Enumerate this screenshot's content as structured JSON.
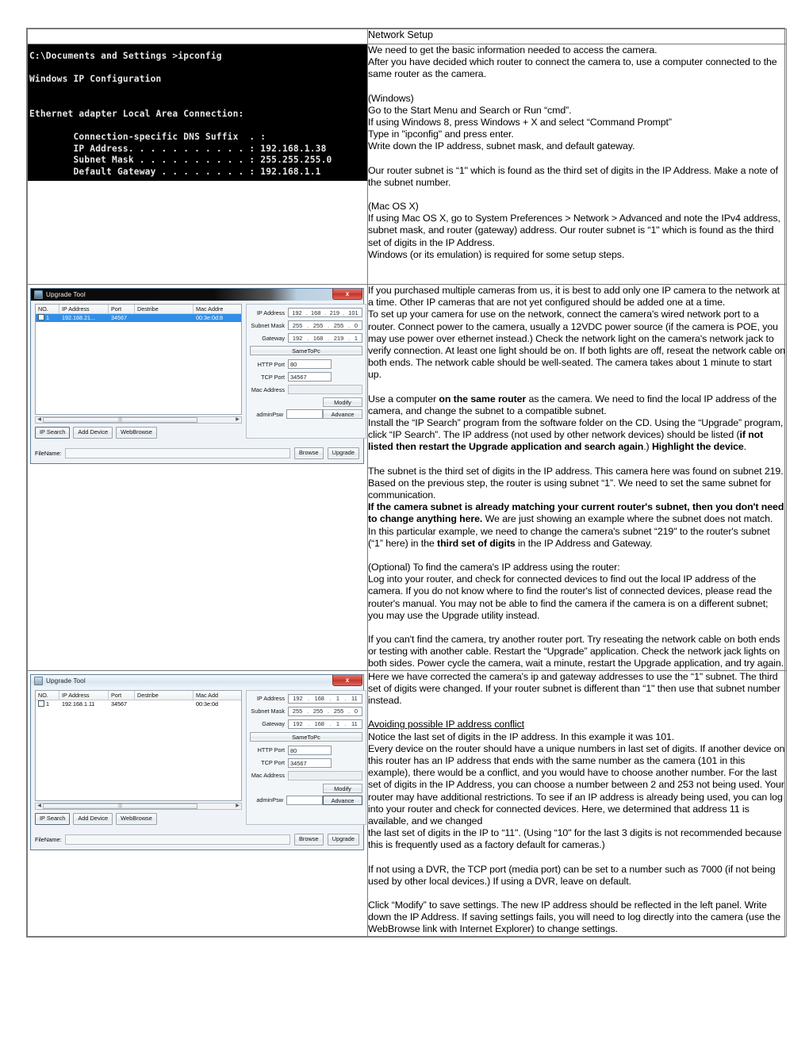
{
  "document": {
    "header_title": "Network Setup"
  },
  "cmd": {
    "lines": [
      "C:\\Documents and Settings >ipconfig",
      "",
      "Windows IP Configuration",
      "",
      "",
      "Ethernet adapter Local Area Connection:",
      "",
      "        Connection-specific DNS Suffix  . :",
      "        IP Address. . . . . . . . . . . : 192.168.1.38",
      "        Subnet Mask . . . . . . . . . . : 255.255.255.0",
      "        Default Gateway . . . . . . . . : 192.168.1.1"
    ]
  },
  "section1": {
    "paragraphs": [
      "We need to get the basic information needed to access the camera.",
      "After you have decided which router to connect the camera to, use a computer connected to the same router as the camera.",
      "(Windows)",
      "Go to the Start Menu and Search or Run “cmd”.",
      "If using Windows 8, press Windows + X and select “Command Prompt”",
      "Type in \"ipconfig\" and press enter.",
      "Write down the IP address, subnet mask, and default gateway.",
      "Our router subnet is “1\" which is found as the third set of digits in the IP Address. Make a note of the subnet number.",
      "(Mac OS X)",
      "If using Mac OS X, go to System Preferences > Network > Advanced and note the IPv4 address, subnet mask, and router (gateway) address. Our router subnet is “1\" which is found as the third set of digits in the IP Address.",
      "Windows (or its emulation) is required for some setup steps."
    ]
  },
  "section2": {
    "p1": "If you purchased multiple cameras from us, it is best to add only one IP camera to the network at a time. Other IP cameras that are not yet configured should be added one at a time.",
    "p2": "To set up your camera for use on the network, connect the camera's wired network port to a router. Connect power to the camera, usually a 12VDC power source (if the camera is POE, you may use power over ethernet instead.) Check the network light on the camera's network jack to verify connection. At least one light should be on. If both lights are off, reseat the network cable on both ends. The network cable should be well-seated. The camera takes about 1 minute to start up.",
    "p3_a": "Use a computer ",
    "p3_b": "on the same router",
    "p3_c": " as the camera. We need to find the local IP address of the camera, and change the subnet to a compatible subnet.",
    "p4_a": "Install the “IP Search” program from the software folder on the CD. Using the “Upgrade” program, click “IP Search”. The IP address (not used by other network devices) should be listed (",
    "p4_b": "if not listed then restart the Upgrade application and search again",
    "p4_c": ".) ",
    "p4_d": "Highlight the device",
    "p4_e": ".",
    "p5": "The subnet is the third set of digits in the IP address. This camera here was found on subnet 219. Based on the previous step, the router is using subnet “1”. We need to set the same subnet for communication.",
    "p6_a": "If the camera subnet is already matching your current router's subnet, then you don't need to change anything here.",
    "p6_b": " We are just showing an example where the subnet does not match.",
    "p7_a": "In this particular example, we need to change the camera's subnet “219\" to the router's subnet (“1” here) in the ",
    "p7_b": "third set of digits",
    "p7_c": " in the IP Address and Gateway.",
    "p8": "(Optional) To find the camera's IP address using the router:",
    "p9": "Log into your router, and check for connected devices to find out the local IP address of the camera. If you do not know where to find the router's list of connected devices, please read the router's manual. You may not be able to find the camera if the camera is on a different subnet; you may use the Upgrade utility instead.",
    "p10": "If you can't find the camera, try another router port. Try reseating the network cable on both ends or testing with another cable. Restart the “Upgrade” application. Check the network jack lights on both sides. Power cycle the camera, wait a minute, restart the Upgrade application, and try again."
  },
  "section3": {
    "p1": "Here we have corrected the camera's ip and gateway addresses to use the “1\" subnet. The third set of digits were changed. If your router subnet is different than “1\" then use that subnet number instead.",
    "heading": "Avoiding possible IP address conflict",
    "p2": "Notice the last set of digits in the IP address. In this example it was 101.",
    "p3": "Every device on the router should have a unique numbers in last set of digits. If another device on this router has an IP address that ends with the same number as the camera (101 in this example), there would be a conflict, and you would have to choose another number. For the last set of digits in the IP Address, you can choose a number between 2 and 253 not being used. Your router may have additional restrictions. To see if an IP address is already being used, you can log into your router and check for connected devices. Here, we determined that address 11 is available, and we changed",
    "p4": "the last set of digits in the IP to “11\". (Using “10\" for the last 3 digits is not recommended because this is frequently used as a factory default for cameras.)",
    "p5": "If not using a DVR, the TCP port (media port) can be set to a number such as 7000 (if not being used by other local devices.) If using a DVR, leave on default.",
    "p6": "Click “Modify” to save settings. The new IP address should be reflected in the left panel. Write down the IP Address. If saving settings fails, you will need to log directly into the camera (use the WebBrowse link with Internet Explorer) to change settings."
  },
  "upgrade_tool_1": {
    "title": "Upgrade Tool",
    "close_label": "x",
    "columns": [
      "NO.",
      "IP Address",
      "Port",
      "Destribe",
      "Mac Addre"
    ],
    "rows": [
      {
        "no": "1",
        "ip": "192.168.21...",
        "port": "34567",
        "describe": "",
        "mac": "00:3e:0d:8"
      }
    ],
    "buttons": {
      "ip_search": "IP Search",
      "add_device": "Add Device",
      "web_browse": "WebBrowse",
      "browse": "Browse",
      "upgrade": "Upgrade"
    },
    "filename_label": "FileName:",
    "filename_value": "",
    "form": {
      "ip_label": "IP Address",
      "ip_octets": [
        "192",
        "168",
        "219",
        "101"
      ],
      "subnet_label": "Subnet Mask",
      "subnet_octets": [
        "255",
        "255",
        "255",
        "0"
      ],
      "gateway_label": "Gateway",
      "gateway_octets": [
        "192",
        "168",
        "219",
        "1"
      ],
      "same_to_pc": "SameToPc",
      "http_port_label": "HTTP Port",
      "http_port_value": "80",
      "tcp_port_label": "TCP Port",
      "tcp_port_value": "34567",
      "mac_label": "Mac Address",
      "mac_value": "",
      "modify": "Modify",
      "advance": "Advance",
      "adminpsw_label": "adminPsw",
      "adminpsw_value": ""
    }
  },
  "upgrade_tool_2": {
    "title": "Upgrade Tool",
    "close_label": "x",
    "columns": [
      "NO.",
      "IP Address",
      "Port",
      "Destribe",
      "Mac Add"
    ],
    "rows": [
      {
        "no": "1",
        "ip": "192.168.1.11",
        "port": "34567",
        "describe": "",
        "mac": "00:3e:0d"
      }
    ],
    "buttons": {
      "ip_search": "IP Search",
      "add_device": "Add Device",
      "web_browse": "WebBrowse",
      "browse": "Browse",
      "upgrade": "Upgrade"
    },
    "filename_label": "FileName:",
    "filename_value": "",
    "form": {
      "ip_label": "IP Address",
      "ip_octets": [
        "192",
        "168",
        "1",
        "11"
      ],
      "subnet_label": "Subnet Mask",
      "subnet_octets": [
        "255",
        "255",
        "255",
        "0"
      ],
      "gateway_label": "Gateway",
      "gateway_octets": [
        "192",
        "168",
        "1",
        "11"
      ],
      "same_to_pc": "SameToPc",
      "http_port_label": "HTTP Port",
      "http_port_value": "80",
      "tcp_port_label": "TCP Port",
      "tcp_port_value": "34567",
      "mac_label": "Mac Address",
      "mac_value": "",
      "modify": "Modify",
      "advance": "Advance",
      "adminpsw_label": "adminPsw",
      "adminpsw_value": ""
    }
  },
  "colors": {
    "selection_blue": "#2f8fe8",
    "close_red": "#c0342c",
    "border_gray": "#7a7a7a"
  }
}
